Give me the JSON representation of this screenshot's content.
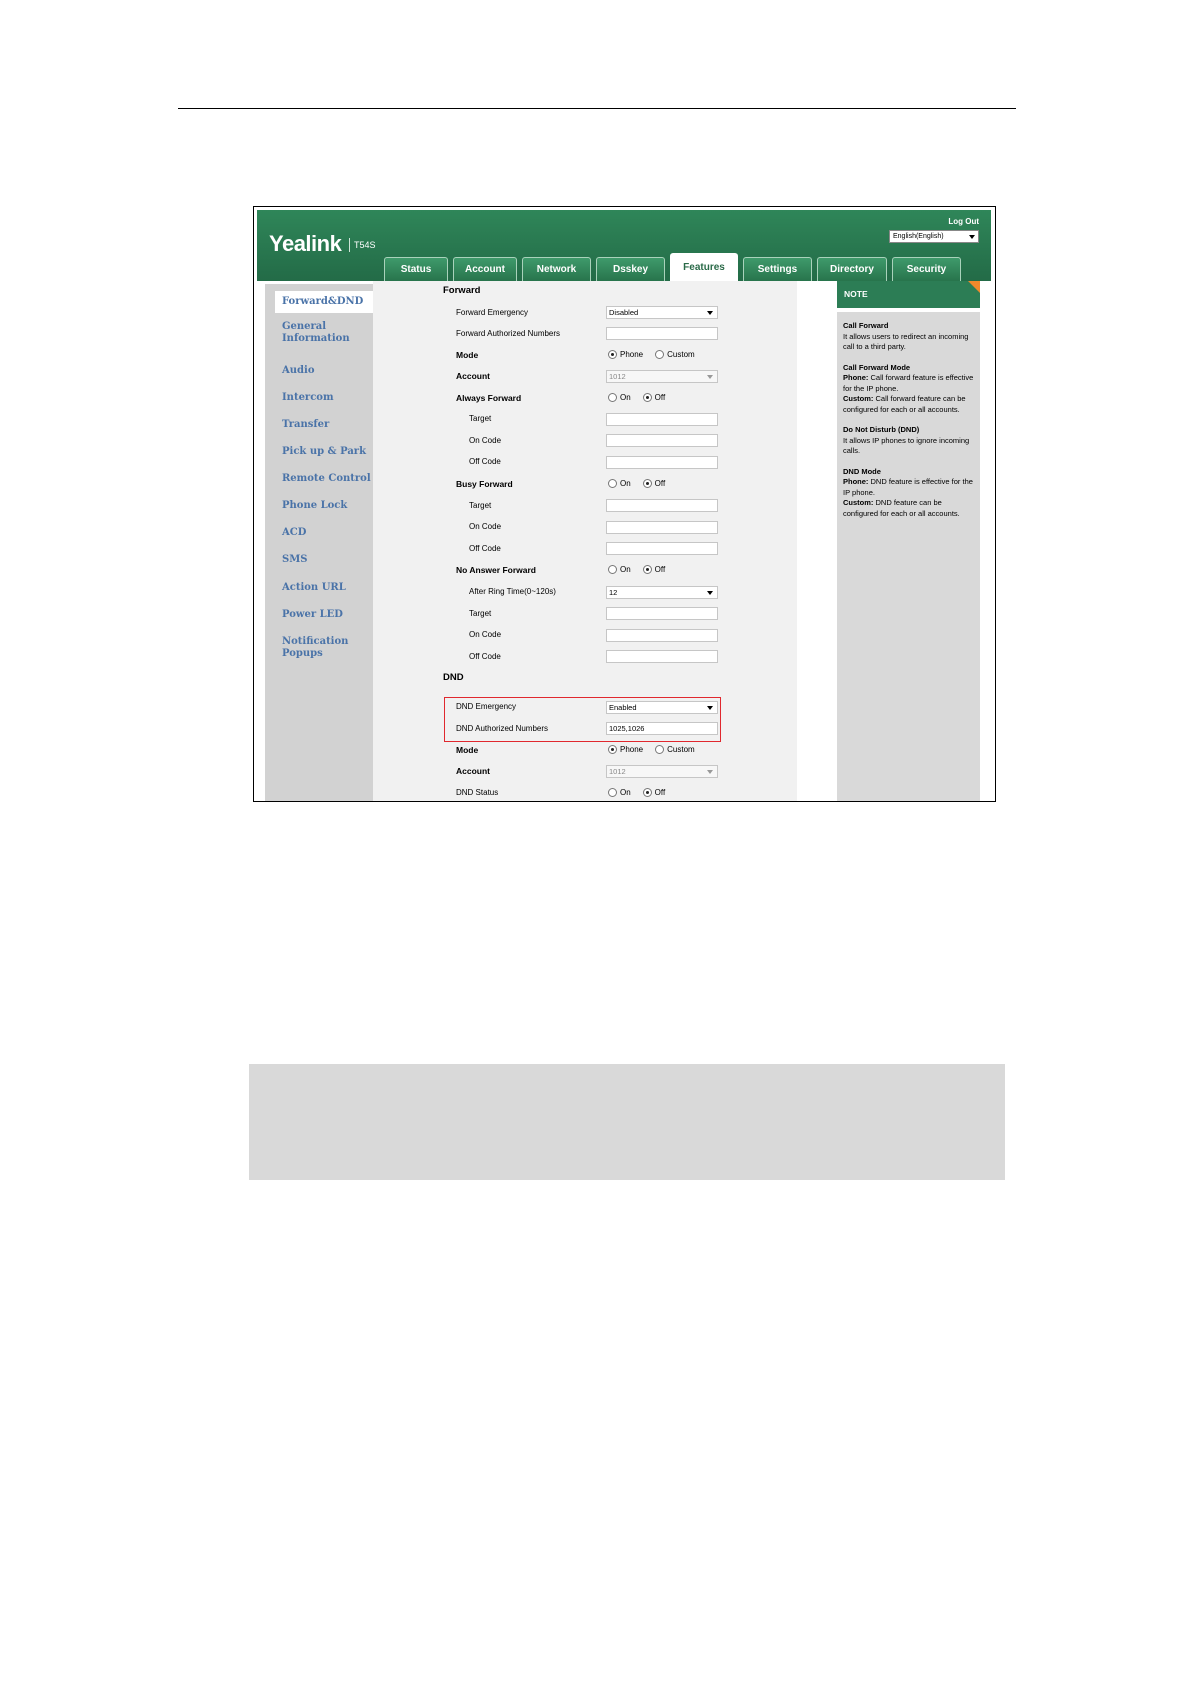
{
  "header": {
    "brand": "Yealink",
    "model": "T54S",
    "logout": "Log Out",
    "language": "English(English)"
  },
  "tabs": [
    "Status",
    "Account",
    "Network",
    "Dsskey",
    "Features",
    "Settings",
    "Directory",
    "Security"
  ],
  "active_tab": "Features",
  "sidebar": {
    "items": [
      "Forward&DND",
      "General Information",
      "Audio",
      "Intercom",
      "Transfer",
      "Pick up & Park",
      "Remote Control",
      "Phone Lock",
      "ACD",
      "SMS",
      "Action URL",
      "Power LED",
      "Notification Popups"
    ]
  },
  "forward": {
    "title": "Forward",
    "emergency_label": "Forward Emergency",
    "emergency_value": "Disabled",
    "authorized_label": "Forward Authorized Numbers",
    "authorized_value": "",
    "mode_label": "Mode",
    "account_label": "Account",
    "account_value": "1012",
    "always_label": "Always Forward",
    "busy_label": "Busy Forward",
    "noanswer_label": "No Answer Forward",
    "ring_time_label": "After Ring Time(0~120s)",
    "ring_time_value": "12",
    "target_label": "Target",
    "on_code_label": "On Code",
    "off_code_label": "Off Code"
  },
  "dnd": {
    "title": "DND",
    "emergency_label": "DND Emergency",
    "emergency_value": "Enabled",
    "authorized_label": "DND Authorized Numbers",
    "authorized_value": "1025,1026",
    "mode_label": "Mode",
    "account_label": "Account",
    "account_value": "1012",
    "status_label": "DND Status"
  },
  "radio_labels": {
    "phone": "Phone",
    "custom": "Custom",
    "on": "On",
    "off": "Off"
  },
  "note": {
    "title": "NOTE",
    "cf_title": "Call Forward",
    "cf_text": "It allows users to redirect an incoming call to a third party.",
    "cfm_title": "Call Forward Mode",
    "cfm_phone_key": "Phone:",
    "cfm_phone_text": " Call forward feature is effective for the IP phone.",
    "cfm_custom_key": "Custom:",
    "cfm_custom_text": " Call forward feature can be configured for each or all accounts.",
    "dnd_title": "Do Not Disturb (DND)",
    "dnd_text": "It allows IP phones to ignore incoming calls.",
    "dndm_title": "DND Mode",
    "dndm_phone_key": "Phone:",
    "dndm_phone_text": " DND feature is effective for the IP phone.",
    "dndm_custom_key": "Custom:",
    "dndm_custom_text": " DND feature can be configured for each or all accounts."
  },
  "colors": {
    "header_green": "#2a7a52",
    "sidebar_gray": "#d2d2d2",
    "link_blue": "#4a73a8",
    "highlight_red": "#e0282e",
    "note_corner": "#f0892c"
  }
}
